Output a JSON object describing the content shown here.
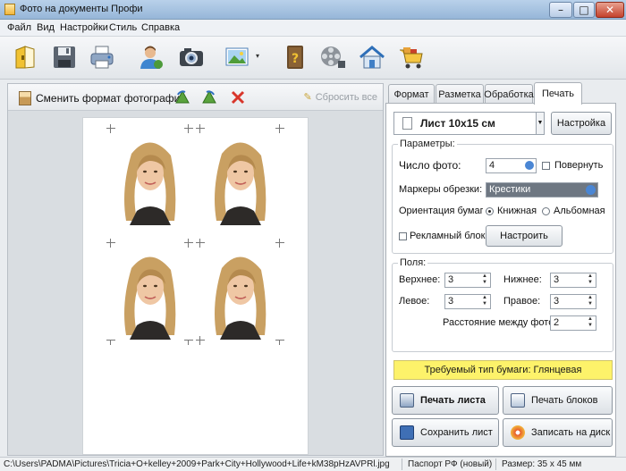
{
  "window": {
    "title": "Фото на документы Профи",
    "controls": {
      "minimize": "–",
      "maximize": "□",
      "close": "✕"
    }
  },
  "menu": [
    "Файл",
    "Вид",
    "Настройки",
    "Стиль",
    "Справка"
  ],
  "toolbar": {
    "icons": [
      "open-folder-icon",
      "save-icon",
      "print-icon",
      "user-photo-icon",
      "camera-icon",
      "image-dropdown-icon",
      "help-book-icon",
      "video-reel-icon",
      "home-icon",
      "shop-cart-icon"
    ],
    "dropdown_arrow": "▾"
  },
  "editor": {
    "change_format_label": "Сменить формат фотографии",
    "reset_all_label": "Сбросить все",
    "cropmark_glyph": "+",
    "photo_count": 4
  },
  "tabs": [
    "Формат",
    "Разметка",
    "Обработка",
    "Печать"
  ],
  "active_tab": "Печать",
  "print": {
    "sheet_size": "Лист 10х15 см",
    "settings_button": "Настройка",
    "params_title": "Параметры:",
    "photo_count_label": "Число фото:",
    "photo_count_value": "4",
    "rotate_label": "Повернуть",
    "crop_markers_label": "Маркеры обрезки:",
    "crop_markers_value": "Крестики",
    "orientation_label": "Ориентация бумаги:",
    "orientation_portrait": "Книжная",
    "orientation_landscape": "Альбомная",
    "ad_block_label": "Рекламный блок:",
    "configure_button": "Настроить",
    "margins_title": "Поля:",
    "top_label": "Верхнее:",
    "top_value": "3",
    "bottom_label": "Нижнее:",
    "bottom_value": "3",
    "left_label": "Левое:",
    "left_value": "3",
    "right_label": "Правое:",
    "right_value": "3",
    "spacing_label": "Расстояние между фото:",
    "spacing_value": "2",
    "paper_type": "Требуемый тип бумаги: Глянцевая",
    "print_sheet_button": "Печать листа",
    "print_blocks_button": "Печать блоков",
    "save_sheet_button": "Сохранить лист",
    "write_disk_button": "Записать на диск"
  },
  "status": {
    "path": "C:\\Users\\PADMA\\Pictures\\Tricia+O+kelley+2009+Park+City+Hollywood+Life+kM38pHzAVPRl.jpg",
    "document_type": "Паспорт РФ (новый)",
    "size": "Размер: 35 x 45 мм"
  },
  "colors": {
    "accent": "#2d6fbf",
    "banner": "#fdf26a"
  }
}
